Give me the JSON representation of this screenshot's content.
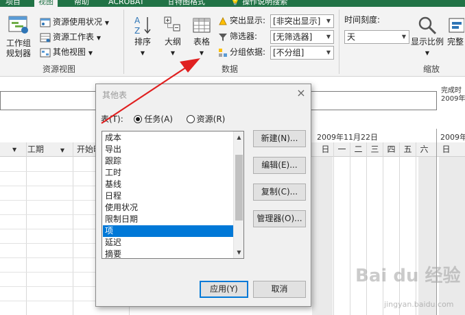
{
  "tabs": [
    {
      "label": "项目",
      "active": false
    },
    {
      "label": "视图",
      "active": true
    },
    {
      "label": "帮助",
      "active": false
    },
    {
      "label": "ACROBAT",
      "active": false
    },
    {
      "label": "甘特图格式",
      "active": false
    },
    {
      "label": "操作说明搜索",
      "active": false
    }
  ],
  "ribbon": {
    "resource_view": {
      "label": "资源视图",
      "team_planner_line1": "工作组",
      "team_planner_line2": "规划器",
      "resource_usage": "资源使用状况",
      "resource_sheet": "资源工作表",
      "other_views": "其他视图"
    },
    "data": {
      "label": "数据",
      "sort": "排序",
      "outline": "大纲",
      "tables": "表格",
      "highlight_label": "突出显示:",
      "highlight_value": "[非突出显示]",
      "filter_label": "筛选器:",
      "filter_value": "[无筛选器]",
      "group_label": "分组依据:",
      "group_value": "[不分组]"
    },
    "zoom": {
      "label": "缩放",
      "timescale_label": "时间刻度:",
      "timescale_value": "天",
      "zoom_btn": "显示比例",
      "complete_btn": "完整"
    }
  },
  "right_info": {
    "line1": "完成时",
    "line2": "2009年"
  },
  "sheet": {
    "col_duration": "工期",
    "col_start": "开始时",
    "week_label_1": "2009年11月22日",
    "week_label_2": "2009年",
    "days": [
      "日",
      "一",
      "二",
      "三",
      "四",
      "五",
      "六",
      "日"
    ]
  },
  "dialog": {
    "title": "其他表",
    "close": "×",
    "table_label": "表(T):",
    "radio_task": "任务(A)",
    "radio_resource": "资源(R)",
    "radio_task_selected": true,
    "items": [
      "成本",
      "导出",
      "跟踪",
      "工时",
      "基线",
      "日程",
      "使用状况",
      "限制日期",
      "项",
      "延迟",
      "摘要"
    ],
    "selected_item": "项",
    "buttons": {
      "new": "新建(N)...",
      "edit": "编辑(E)...",
      "copy": "复制(C)...",
      "organizer": "管理器(O)...",
      "apply": "应用(Y)",
      "cancel": "取消"
    }
  },
  "watermark": {
    "main": "Bai du 经验",
    "sub": "jingyan.baidu.com"
  },
  "colors": {
    "ribbon_green": "#217346",
    "selection": "#0078d7",
    "arrow": "#e02020"
  }
}
